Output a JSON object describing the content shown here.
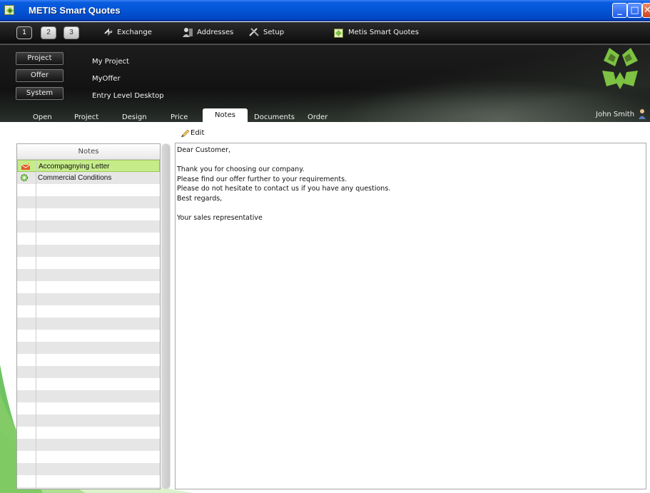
{
  "window": {
    "title": "METIS Smart Quotes",
    "minimize": "_",
    "maximize": "□",
    "close": "✕"
  },
  "toolbar": {
    "pages": [
      "1",
      "2",
      "3"
    ],
    "exchange": "Exchange",
    "addresses": "Addresses",
    "setup": "Setup",
    "app_link": "Metis Smart Quotes"
  },
  "context": {
    "project_button": "Project",
    "offer_button": "Offer",
    "system_button": "System",
    "project_value": "My Project",
    "offer_value": "MyOffer",
    "system_value": "Entry Level Desktop"
  },
  "tabs": [
    "Open",
    "Project",
    "Design",
    "Price",
    "Notes",
    "Documents",
    "Order"
  ],
  "active_tab": "Notes",
  "user": "John Smith",
  "notes": {
    "edit_label": "Edit",
    "header": "Notes",
    "items": [
      {
        "label": "Accompagnying Letter",
        "icon": "letter-icon",
        "selected": true
      },
      {
        "label": "Commercial Conditions",
        "icon": "gear-icon",
        "selected": false
      }
    ]
  },
  "editor": {
    "lines": [
      "Dear Customer,",
      "",
      "Thank you for choosing our company.",
      "Please find our offer further to your requirements.",
      "Please do not hesitate to contact us if you have any questions.",
      "Best regards,",
      "",
      "Your sales representative"
    ]
  },
  "colors": {
    "brand_green": "#7dc242",
    "selection": "#c6ec8a",
    "xp_blue": "#0355d6"
  }
}
